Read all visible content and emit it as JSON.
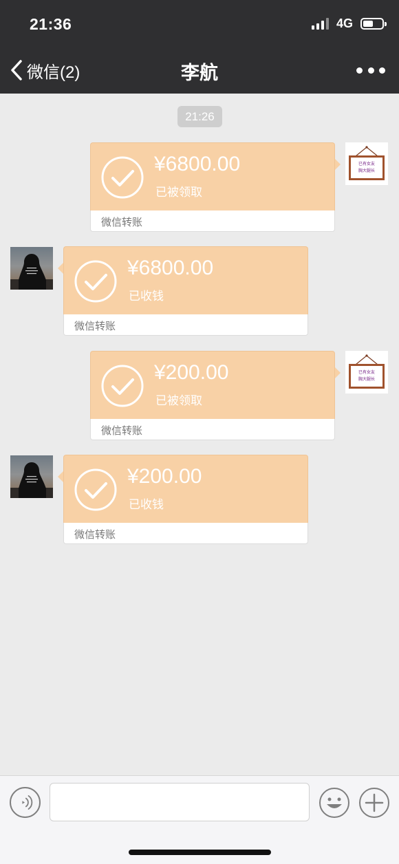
{
  "status_bar": {
    "time": "21:36",
    "network": "4G",
    "battery_fraction": 0.55
  },
  "nav": {
    "back_label": "微信(2)",
    "title": "李航",
    "more_icon": "more-dots-icon"
  },
  "chat": {
    "timestamp": "21:26",
    "messages": [
      {
        "sender": "me",
        "amount": "¥6800.00",
        "status": "已被领取",
        "label": "微信转账"
      },
      {
        "sender": "other",
        "amount": "¥6800.00",
        "status": "已收钱",
        "label": "微信转账"
      },
      {
        "sender": "me",
        "amount": "¥200.00",
        "status": "已被领取",
        "label": "微信转账"
      },
      {
        "sender": "other",
        "amount": "¥200.00",
        "status": "已收钱",
        "label": "微信转账"
      }
    ],
    "my_avatar_sign_text": [
      "已有女友",
      "胸大腿长"
    ]
  },
  "input_bar": {
    "placeholder": "",
    "icons": [
      "voice-icon",
      "emoji-icon",
      "plus-icon"
    ]
  },
  "colors": {
    "transfer_bubble": "#f8d1a6",
    "nav_bg": "#2f2f31",
    "chat_bg": "#ebebeb",
    "sign_text": "#7a2a8a"
  }
}
